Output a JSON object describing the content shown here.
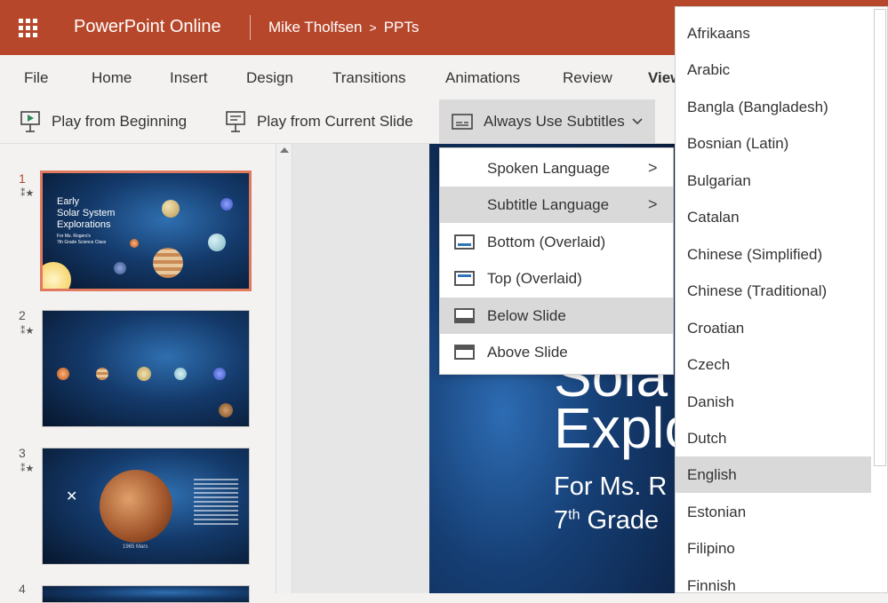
{
  "app": {
    "name": "PowerPoint Online",
    "owner": "Mike Tholfsen",
    "separator": ">",
    "folder": "PPTs"
  },
  "tabs": [
    "File",
    "Home",
    "Insert",
    "Design",
    "Transitions",
    "Animations",
    "Review",
    "View"
  ],
  "ribbon": {
    "play_beginning": "Play from Beginning",
    "play_current": "Play from Current Slide",
    "subtitles": "Always Use Subtitles"
  },
  "slides": [
    {
      "number": "1",
      "title_lines": [
        "Early",
        "Solar System",
        "Explorations"
      ],
      "sub_lines": [
        "For Ms. Rogers's",
        "7th Grade Science Class"
      ]
    },
    {
      "number": "2"
    },
    {
      "number": "3",
      "caption": "1965 Mars"
    },
    {
      "number": "4"
    }
  ],
  "main_slide": {
    "title1": "Sola",
    "title2": "Explo",
    "sub1": "For Ms. R",
    "sub2_base": "7",
    "sub2_sup": "th",
    "sub2_rest": " Grade"
  },
  "subtitle_menu": {
    "spoken": "Spoken Language",
    "subtitle_lang": "Subtitle Language",
    "bottom": "Bottom (Overlaid)",
    "top": "Top (Overlaid)",
    "below": "Below Slide",
    "above": "Above Slide",
    "chevron": ">"
  },
  "languages": [
    "Afrikaans",
    "Arabic",
    "Bangla (Bangladesh)",
    "Bosnian (Latin)",
    "Bulgarian",
    "Catalan",
    "Chinese (Simplified)",
    "Chinese (Traditional)",
    "Croatian",
    "Czech",
    "Danish",
    "Dutch",
    "English",
    "Estonian",
    "Filipino",
    "Finnish"
  ],
  "selected_language": "English",
  "colors": {
    "brand": "#b7472a",
    "highlight": "#d9d9d9",
    "accent": "#2e75b6"
  }
}
